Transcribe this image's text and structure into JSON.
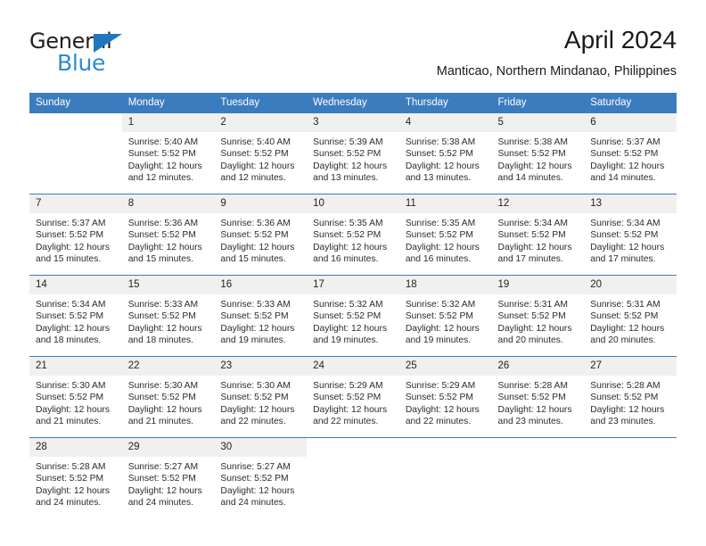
{
  "logo": {
    "word1": "General",
    "word2": "Blue",
    "triangle_color": "#1f77bd",
    "word2_color": "#2e8bd0"
  },
  "header": {
    "title": "April 2024",
    "subtitle": "Manticao, Northern Mindanao, Philippines"
  },
  "theme": {
    "header_bg": "#3b7cbf",
    "daynum_bg": "#f0f0f0",
    "grid_line": "#3b7cbf"
  },
  "weekday_headers": [
    "Sunday",
    "Monday",
    "Tuesday",
    "Wednesday",
    "Thursday",
    "Friday",
    "Saturday"
  ],
  "labels": {
    "sunrise_prefix": "Sunrise:",
    "sunset_prefix": "Sunset:",
    "daylight_prefix": "Daylight:"
  },
  "weeks": [
    [
      {
        "day": "",
        "sunrise": "",
        "sunset": "",
        "daylight_line1": "",
        "daylight_line2": ""
      },
      {
        "day": "1",
        "sunrise": "Sunrise: 5:40 AM",
        "sunset": "Sunset: 5:52 PM",
        "daylight_line1": "Daylight: 12 hours",
        "daylight_line2": "and 12 minutes."
      },
      {
        "day": "2",
        "sunrise": "Sunrise: 5:40 AM",
        "sunset": "Sunset: 5:52 PM",
        "daylight_line1": "Daylight: 12 hours",
        "daylight_line2": "and 12 minutes."
      },
      {
        "day": "3",
        "sunrise": "Sunrise: 5:39 AM",
        "sunset": "Sunset: 5:52 PM",
        "daylight_line1": "Daylight: 12 hours",
        "daylight_line2": "and 13 minutes."
      },
      {
        "day": "4",
        "sunrise": "Sunrise: 5:38 AM",
        "sunset": "Sunset: 5:52 PM",
        "daylight_line1": "Daylight: 12 hours",
        "daylight_line2": "and 13 minutes."
      },
      {
        "day": "5",
        "sunrise": "Sunrise: 5:38 AM",
        "sunset": "Sunset: 5:52 PM",
        "daylight_line1": "Daylight: 12 hours",
        "daylight_line2": "and 14 minutes."
      },
      {
        "day": "6",
        "sunrise": "Sunrise: 5:37 AM",
        "sunset": "Sunset: 5:52 PM",
        "daylight_line1": "Daylight: 12 hours",
        "daylight_line2": "and 14 minutes."
      }
    ],
    [
      {
        "day": "7",
        "sunrise": "Sunrise: 5:37 AM",
        "sunset": "Sunset: 5:52 PM",
        "daylight_line1": "Daylight: 12 hours",
        "daylight_line2": "and 15 minutes."
      },
      {
        "day": "8",
        "sunrise": "Sunrise: 5:36 AM",
        "sunset": "Sunset: 5:52 PM",
        "daylight_line1": "Daylight: 12 hours",
        "daylight_line2": "and 15 minutes."
      },
      {
        "day": "9",
        "sunrise": "Sunrise: 5:36 AM",
        "sunset": "Sunset: 5:52 PM",
        "daylight_line1": "Daylight: 12 hours",
        "daylight_line2": "and 15 minutes."
      },
      {
        "day": "10",
        "sunrise": "Sunrise: 5:35 AM",
        "sunset": "Sunset: 5:52 PM",
        "daylight_line1": "Daylight: 12 hours",
        "daylight_line2": "and 16 minutes."
      },
      {
        "day": "11",
        "sunrise": "Sunrise: 5:35 AM",
        "sunset": "Sunset: 5:52 PM",
        "daylight_line1": "Daylight: 12 hours",
        "daylight_line2": "and 16 minutes."
      },
      {
        "day": "12",
        "sunrise": "Sunrise: 5:34 AM",
        "sunset": "Sunset: 5:52 PM",
        "daylight_line1": "Daylight: 12 hours",
        "daylight_line2": "and 17 minutes."
      },
      {
        "day": "13",
        "sunrise": "Sunrise: 5:34 AM",
        "sunset": "Sunset: 5:52 PM",
        "daylight_line1": "Daylight: 12 hours",
        "daylight_line2": "and 17 minutes."
      }
    ],
    [
      {
        "day": "14",
        "sunrise": "Sunrise: 5:34 AM",
        "sunset": "Sunset: 5:52 PM",
        "daylight_line1": "Daylight: 12 hours",
        "daylight_line2": "and 18 minutes."
      },
      {
        "day": "15",
        "sunrise": "Sunrise: 5:33 AM",
        "sunset": "Sunset: 5:52 PM",
        "daylight_line1": "Daylight: 12 hours",
        "daylight_line2": "and 18 minutes."
      },
      {
        "day": "16",
        "sunrise": "Sunrise: 5:33 AM",
        "sunset": "Sunset: 5:52 PM",
        "daylight_line1": "Daylight: 12 hours",
        "daylight_line2": "and 19 minutes."
      },
      {
        "day": "17",
        "sunrise": "Sunrise: 5:32 AM",
        "sunset": "Sunset: 5:52 PM",
        "daylight_line1": "Daylight: 12 hours",
        "daylight_line2": "and 19 minutes."
      },
      {
        "day": "18",
        "sunrise": "Sunrise: 5:32 AM",
        "sunset": "Sunset: 5:52 PM",
        "daylight_line1": "Daylight: 12 hours",
        "daylight_line2": "and 19 minutes."
      },
      {
        "day": "19",
        "sunrise": "Sunrise: 5:31 AM",
        "sunset": "Sunset: 5:52 PM",
        "daylight_line1": "Daylight: 12 hours",
        "daylight_line2": "and 20 minutes."
      },
      {
        "day": "20",
        "sunrise": "Sunrise: 5:31 AM",
        "sunset": "Sunset: 5:52 PM",
        "daylight_line1": "Daylight: 12 hours",
        "daylight_line2": "and 20 minutes."
      }
    ],
    [
      {
        "day": "21",
        "sunrise": "Sunrise: 5:30 AM",
        "sunset": "Sunset: 5:52 PM",
        "daylight_line1": "Daylight: 12 hours",
        "daylight_line2": "and 21 minutes."
      },
      {
        "day": "22",
        "sunrise": "Sunrise: 5:30 AM",
        "sunset": "Sunset: 5:52 PM",
        "daylight_line1": "Daylight: 12 hours",
        "daylight_line2": "and 21 minutes."
      },
      {
        "day": "23",
        "sunrise": "Sunrise: 5:30 AM",
        "sunset": "Sunset: 5:52 PM",
        "daylight_line1": "Daylight: 12 hours",
        "daylight_line2": "and 22 minutes."
      },
      {
        "day": "24",
        "sunrise": "Sunrise: 5:29 AM",
        "sunset": "Sunset: 5:52 PM",
        "daylight_line1": "Daylight: 12 hours",
        "daylight_line2": "and 22 minutes."
      },
      {
        "day": "25",
        "sunrise": "Sunrise: 5:29 AM",
        "sunset": "Sunset: 5:52 PM",
        "daylight_line1": "Daylight: 12 hours",
        "daylight_line2": "and 22 minutes."
      },
      {
        "day": "26",
        "sunrise": "Sunrise: 5:28 AM",
        "sunset": "Sunset: 5:52 PM",
        "daylight_line1": "Daylight: 12 hours",
        "daylight_line2": "and 23 minutes."
      },
      {
        "day": "27",
        "sunrise": "Sunrise: 5:28 AM",
        "sunset": "Sunset: 5:52 PM",
        "daylight_line1": "Daylight: 12 hours",
        "daylight_line2": "and 23 minutes."
      }
    ],
    [
      {
        "day": "28",
        "sunrise": "Sunrise: 5:28 AM",
        "sunset": "Sunset: 5:52 PM",
        "daylight_line1": "Daylight: 12 hours",
        "daylight_line2": "and 24 minutes."
      },
      {
        "day": "29",
        "sunrise": "Sunrise: 5:27 AM",
        "sunset": "Sunset: 5:52 PM",
        "daylight_line1": "Daylight: 12 hours",
        "daylight_line2": "and 24 minutes."
      },
      {
        "day": "30",
        "sunrise": "Sunrise: 5:27 AM",
        "sunset": "Sunset: 5:52 PM",
        "daylight_line1": "Daylight: 12 hours",
        "daylight_line2": "and 24 minutes."
      },
      {
        "day": "",
        "sunrise": "",
        "sunset": "",
        "daylight_line1": "",
        "daylight_line2": ""
      },
      {
        "day": "",
        "sunrise": "",
        "sunset": "",
        "daylight_line1": "",
        "daylight_line2": ""
      },
      {
        "day": "",
        "sunrise": "",
        "sunset": "",
        "daylight_line1": "",
        "daylight_line2": ""
      },
      {
        "day": "",
        "sunrise": "",
        "sunset": "",
        "daylight_line1": "",
        "daylight_line2": ""
      }
    ]
  ]
}
